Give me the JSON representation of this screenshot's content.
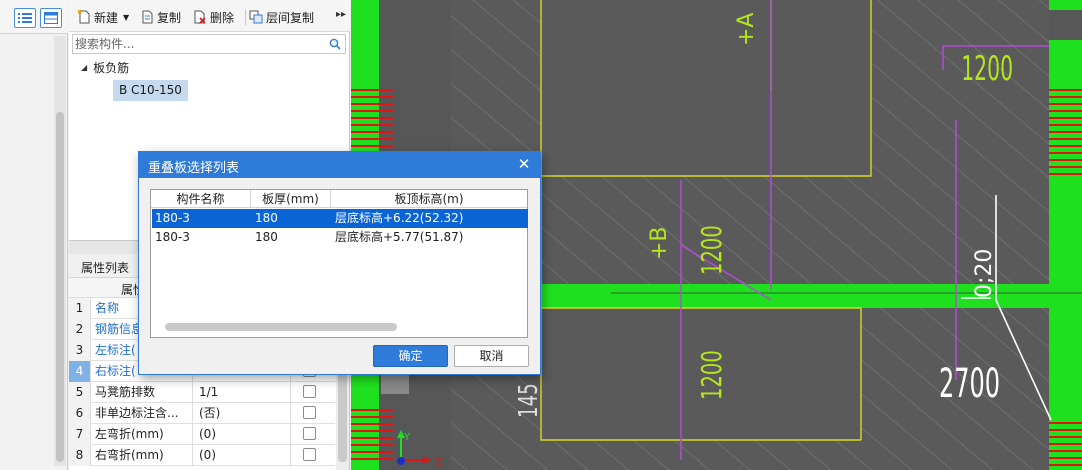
{
  "toolbar": {
    "new_label": "新建",
    "copy_label": "复制",
    "delete_label": "删除",
    "floor_copy_label": "层间复制",
    "more_glyph": "▸▸"
  },
  "search": {
    "placeholder": "搜索构件..."
  },
  "tree": {
    "root_label": "板负筋",
    "child_label": "B C10-150"
  },
  "properties": {
    "title": "属性列表",
    "column_header": "属性",
    "rows": [
      {
        "num": "1",
        "name": "名称",
        "value": "",
        "selected": false
      },
      {
        "num": "2",
        "name": "钢筋信息",
        "value": "",
        "selected": false
      },
      {
        "num": "3",
        "name": "左标注(",
        "value": "",
        "selected": false
      },
      {
        "num": "4",
        "name": "右标注(",
        "value": "",
        "selected": true
      },
      {
        "num": "5",
        "name": "马凳筋排数",
        "value": "1/1",
        "selected": false
      },
      {
        "num": "6",
        "name": "非单边标注含...",
        "value": "(否)",
        "selected": false
      },
      {
        "num": "7",
        "name": "左弯折(mm)",
        "value": "(0)",
        "selected": false
      },
      {
        "num": "8",
        "name": "右弯折(mm)",
        "value": "(0)",
        "selected": false
      }
    ]
  },
  "dialog": {
    "title": "重叠板选择列表",
    "close_glyph": "✕",
    "columns": [
      "构件名称",
      "板厚(mm)",
      "板顶标高(m)"
    ],
    "rows": [
      {
        "name": "180-3",
        "thickness": "180",
        "elevation": "层底标高+6.22(52.32)"
      },
      {
        "name": "180-3",
        "thickness": "180",
        "elevation": "层底标高+5.77(51.87)"
      }
    ],
    "selected_row": 0,
    "ok_label": "确定",
    "cancel_label": "取消"
  },
  "cad": {
    "labels": {
      "dim_top_right": "1200",
      "dim_center": "1200",
      "dim_lower_center": "1200",
      "dim_right": "2700",
      "marker_a": "+A",
      "marker_b": "+B",
      "angle_text": "0;20",
      "partial_text": "145"
    },
    "axis_x": "X",
    "axis_y": "Y",
    "colors": {
      "background": "#5a5a5a",
      "beam_green": "#1fe01f",
      "rebar_red": "#e01414",
      "outline_yellow": "#d7d728",
      "label_yellow_green": "#b4e61e",
      "magenta": "#b34bd6"
    }
  }
}
